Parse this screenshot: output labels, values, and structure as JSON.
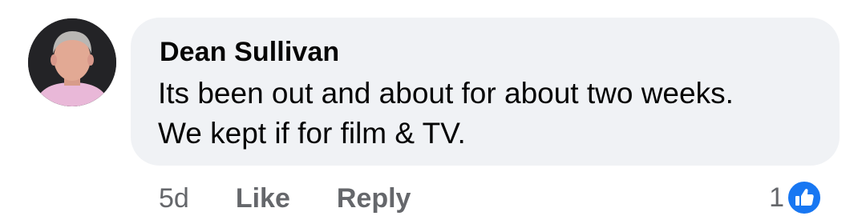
{
  "comment": {
    "author": "Dean Sullivan",
    "text_lines": [
      "Its been out and about for about two weeks.",
      "We kept if for film & TV."
    ]
  },
  "actions": {
    "timestamp": "5d",
    "like_label": "Like",
    "reply_label": "Reply"
  },
  "reactions": {
    "count": "1",
    "icon": "thumbs-up-icon",
    "color": "#1877f2"
  },
  "avatar": {
    "icon": "user-avatar-photo"
  }
}
